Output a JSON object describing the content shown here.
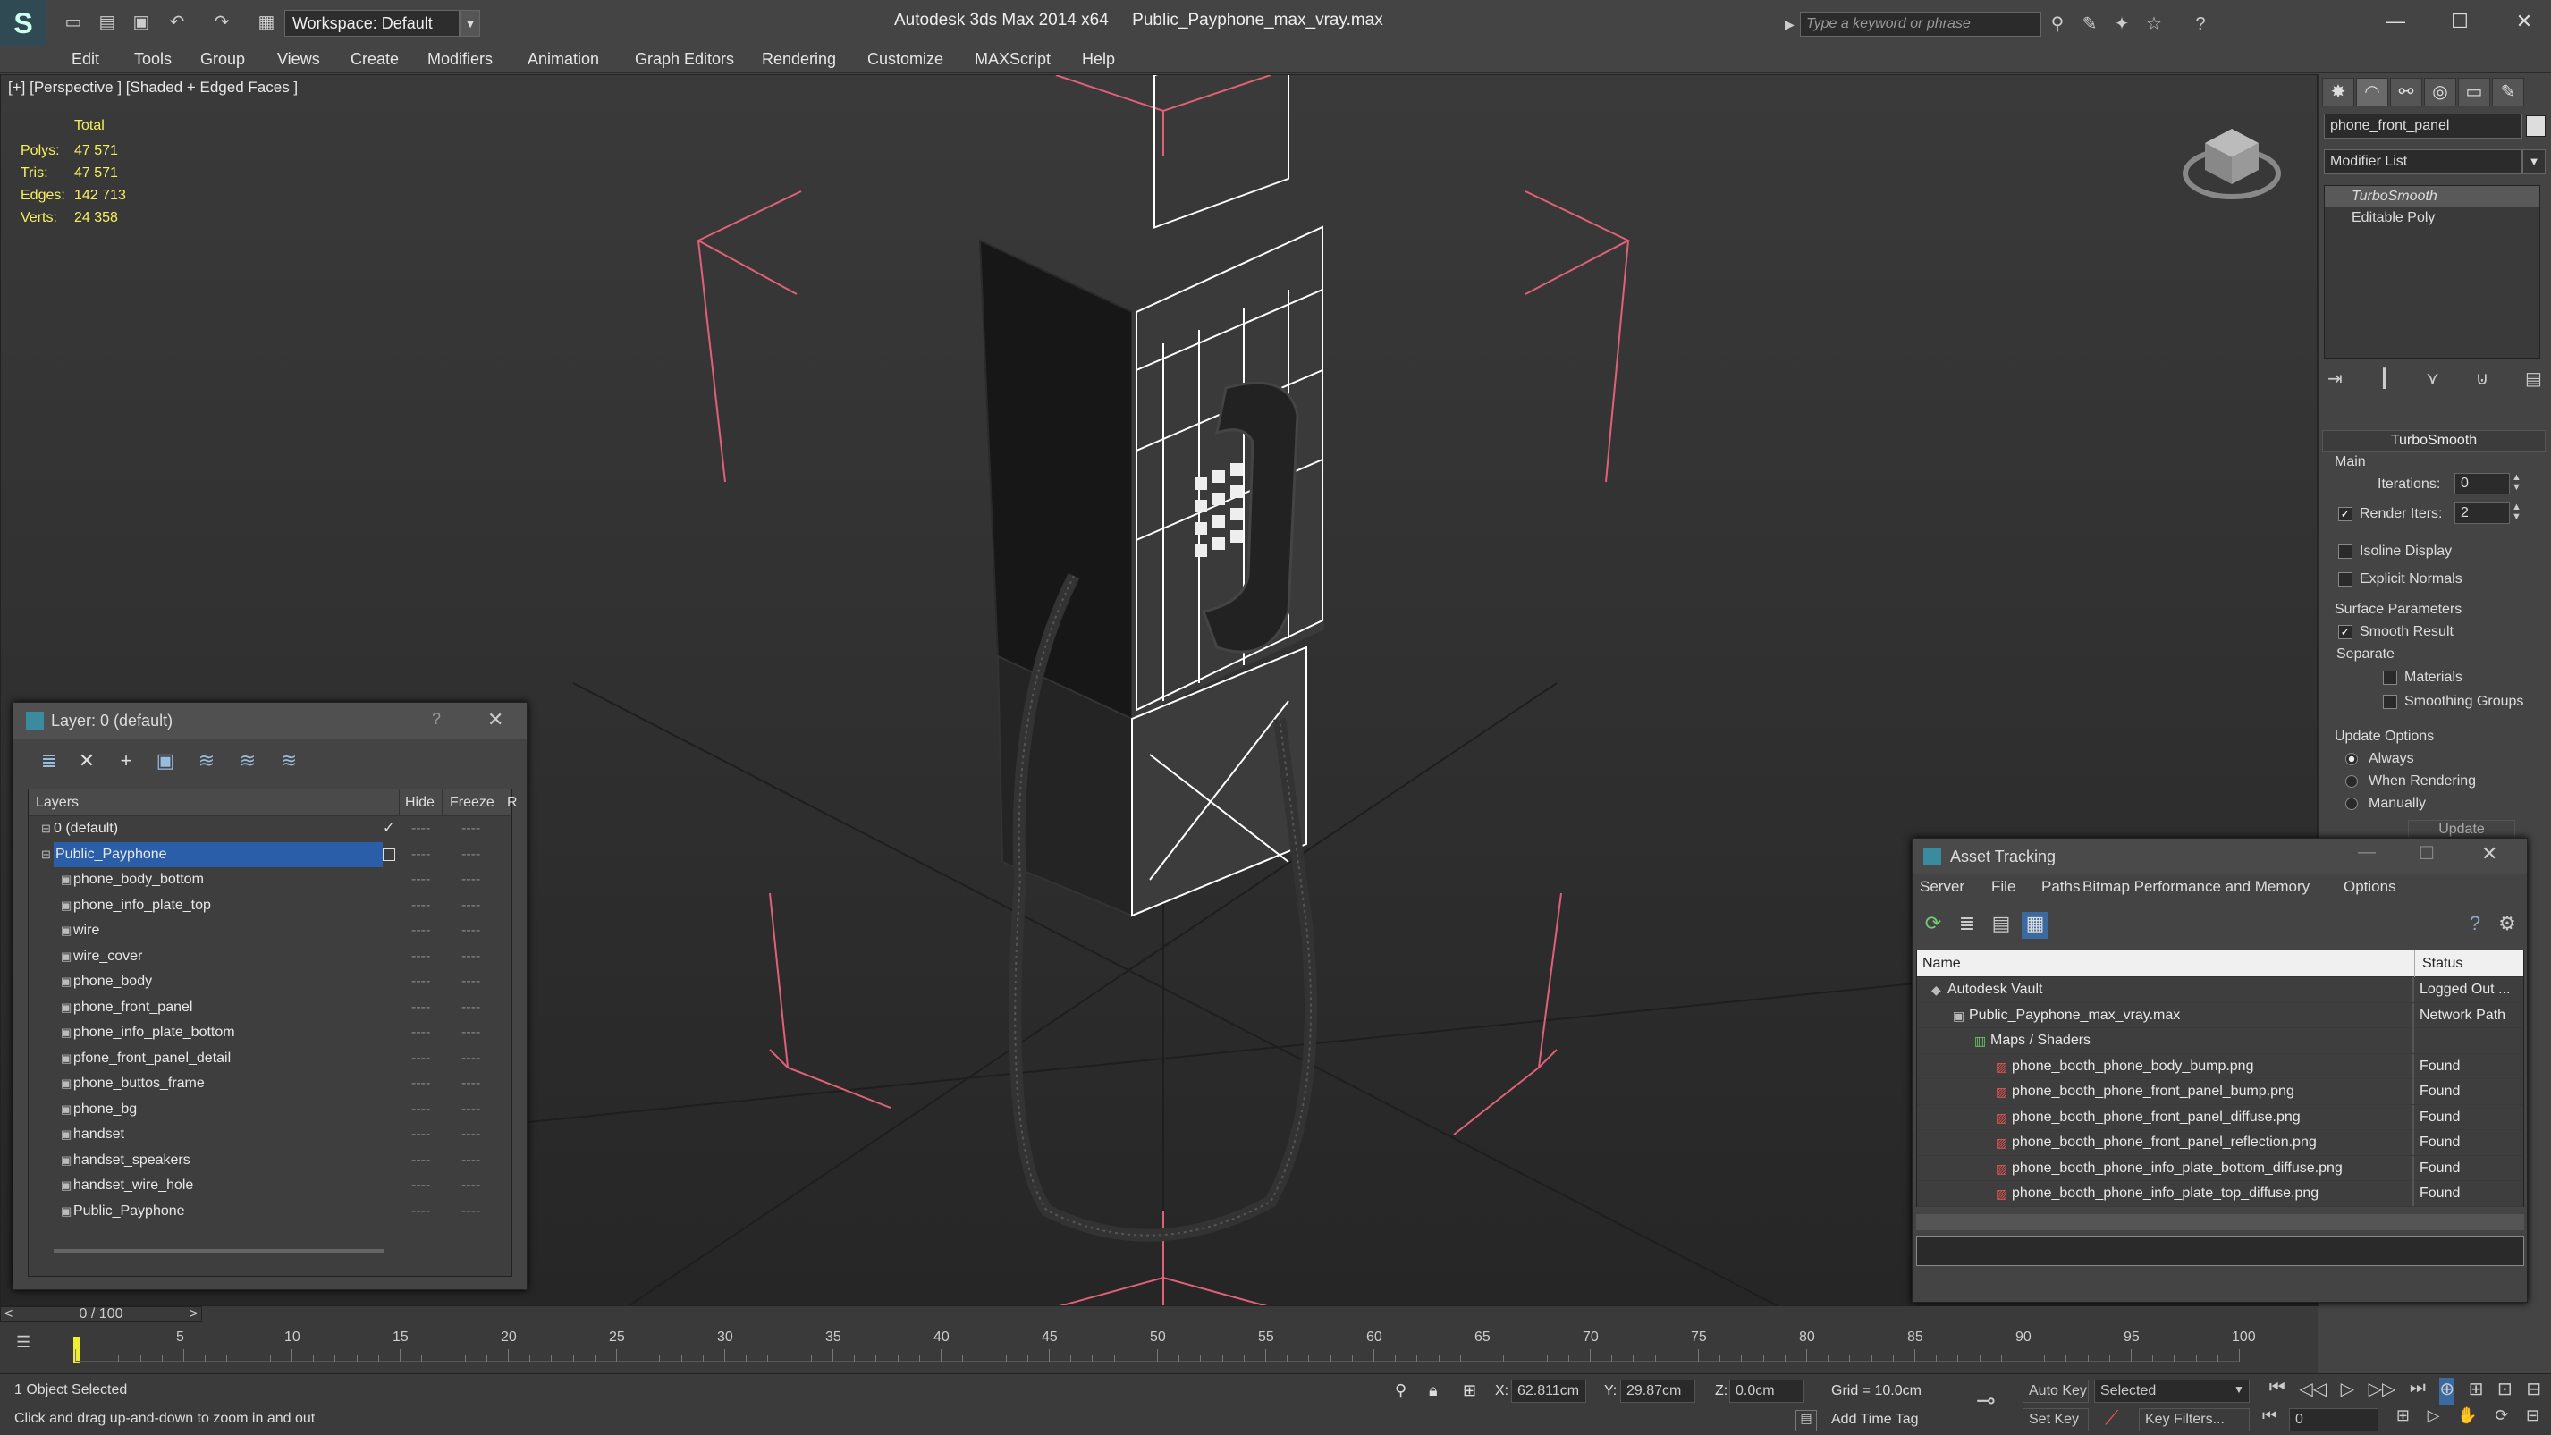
{
  "titlebar": {
    "workspace": "Workspace: Default",
    "app_title": "Autodesk 3ds Max  2014 x64",
    "file_title": "Public_Payphone_max_vray.max",
    "search_placeholder": "Type a keyword or phrase"
  },
  "menu": [
    "Edit",
    "Tools",
    "Group",
    "Views",
    "Create",
    "Modifiers",
    "Animation",
    "Graph Editors",
    "Rendering",
    "Customize",
    "MAXScript",
    "Help"
  ],
  "viewport": {
    "label": "[+] [Perspective ] [Shaded + Edged Faces ]",
    "stats": {
      "header": "Total",
      "rows": [
        {
          "label": "Polys:",
          "value": "47 571"
        },
        {
          "label": "Tris:",
          "value": "47 571"
        },
        {
          "label": "Edges:",
          "value": "142 713"
        },
        {
          "label": "Verts:",
          "value": "24 358"
        }
      ]
    }
  },
  "command_panel": {
    "object_name": "phone_front_panel",
    "modifier_list": "Modifier List",
    "stack": [
      "TurboSmooth",
      "Editable Poly"
    ],
    "rollout_title": "TurboSmooth",
    "main_group": "Main",
    "iterations_label": "Iterations:",
    "iterations_value": "0",
    "render_iters_label": "Render Iters:",
    "render_iters_value": "2",
    "isoline": "Isoline Display",
    "explicit_normals": "Explicit Normals",
    "surface_group": "Surface Parameters",
    "smooth_result": "Smooth Result",
    "separate": "Separate",
    "materials": "Materials",
    "smoothing_groups": "Smoothing Groups",
    "update_group": "Update Options",
    "always": "Always",
    "when_rendering": "When Rendering",
    "manually": "Manually",
    "update_btn": "Update"
  },
  "layer_dialog": {
    "title": "Layer: 0 (default)",
    "help": "?",
    "columns": {
      "layers": "Layers",
      "hide": "Hide",
      "freeze": "Freeze",
      "r": "R"
    },
    "rows": [
      {
        "name": "0 (default)",
        "level": 0
      },
      {
        "name": "Public_Payphone",
        "level": 0
      },
      {
        "name": "phone_body_bottom",
        "level": 1
      },
      {
        "name": "phone_info_plate_top",
        "level": 1
      },
      {
        "name": "wire",
        "level": 1
      },
      {
        "name": "wire_cover",
        "level": 1
      },
      {
        "name": "phone_body",
        "level": 1
      },
      {
        "name": "phone_front_panel",
        "level": 1
      },
      {
        "name": "phone_info_plate_bottom",
        "level": 1
      },
      {
        "name": "pfone_front_panel_detail",
        "level": 1
      },
      {
        "name": "phone_buttos_frame",
        "level": 1
      },
      {
        "name": "phone_bg",
        "level": 1
      },
      {
        "name": "handset",
        "level": 1
      },
      {
        "name": "handset_speakers",
        "level": 1
      },
      {
        "name": "handset_wire_hole",
        "level": 1
      },
      {
        "name": "Public_Payphone",
        "level": 1
      }
    ],
    "dash": "----"
  },
  "asset_dialog": {
    "title": "Asset Tracking",
    "menu": [
      "Server",
      "File",
      "Paths",
      "Bitmap Performance and Memory",
      "Options"
    ],
    "columns": {
      "name": "Name",
      "status": "Status"
    },
    "rows": [
      {
        "name": "Autodesk Vault",
        "status": "Logged Out ...",
        "level": 0
      },
      {
        "name": "Public_Payphone_max_vray.max",
        "status": "Network Path",
        "level": 1
      },
      {
        "name": "Maps / Shaders",
        "status": "",
        "level": 2
      },
      {
        "name": "phone_booth_phone_body_bump.png",
        "status": "Found",
        "level": 3
      },
      {
        "name": "phone_booth_phone_front_panel_bump.png",
        "status": "Found",
        "level": 3
      },
      {
        "name": "phone_booth_phone_front_panel_diffuse.png",
        "status": "Found",
        "level": 3
      },
      {
        "name": "phone_booth_phone_front_panel_reflection.png",
        "status": "Found",
        "level": 3
      },
      {
        "name": "phone_booth_phone_info_plate_bottom_diffuse.png",
        "status": "Found",
        "level": 3
      },
      {
        "name": "phone_booth_phone_info_plate_top_diffuse.png",
        "status": "Found",
        "level": 3
      }
    ]
  },
  "timeline": {
    "frame": "0 / 100",
    "ticks": [
      "0",
      "5",
      "10",
      "15",
      "20",
      "25",
      "30",
      "35",
      "40",
      "45",
      "50",
      "55",
      "60",
      "65",
      "70",
      "75",
      "80",
      "85",
      "90",
      "95",
      "100"
    ]
  },
  "status": {
    "selected": "1 Object Selected",
    "prompt": "Click and drag up-and-down to zoom in and out",
    "x_label": "X:",
    "x_value": "62.811cm",
    "y_label": "Y:",
    "y_value": "29.87cm",
    "z_label": "Z:",
    "z_value": "0.0cm",
    "grid": "Grid = 10.0cm",
    "auto_key": "Auto Key",
    "selected_dropdown": "Selected",
    "set_key": "Set Key",
    "key_filters": "Key Filters...",
    "add_time_tag": "Add Time Tag",
    "frame_field": "0"
  }
}
